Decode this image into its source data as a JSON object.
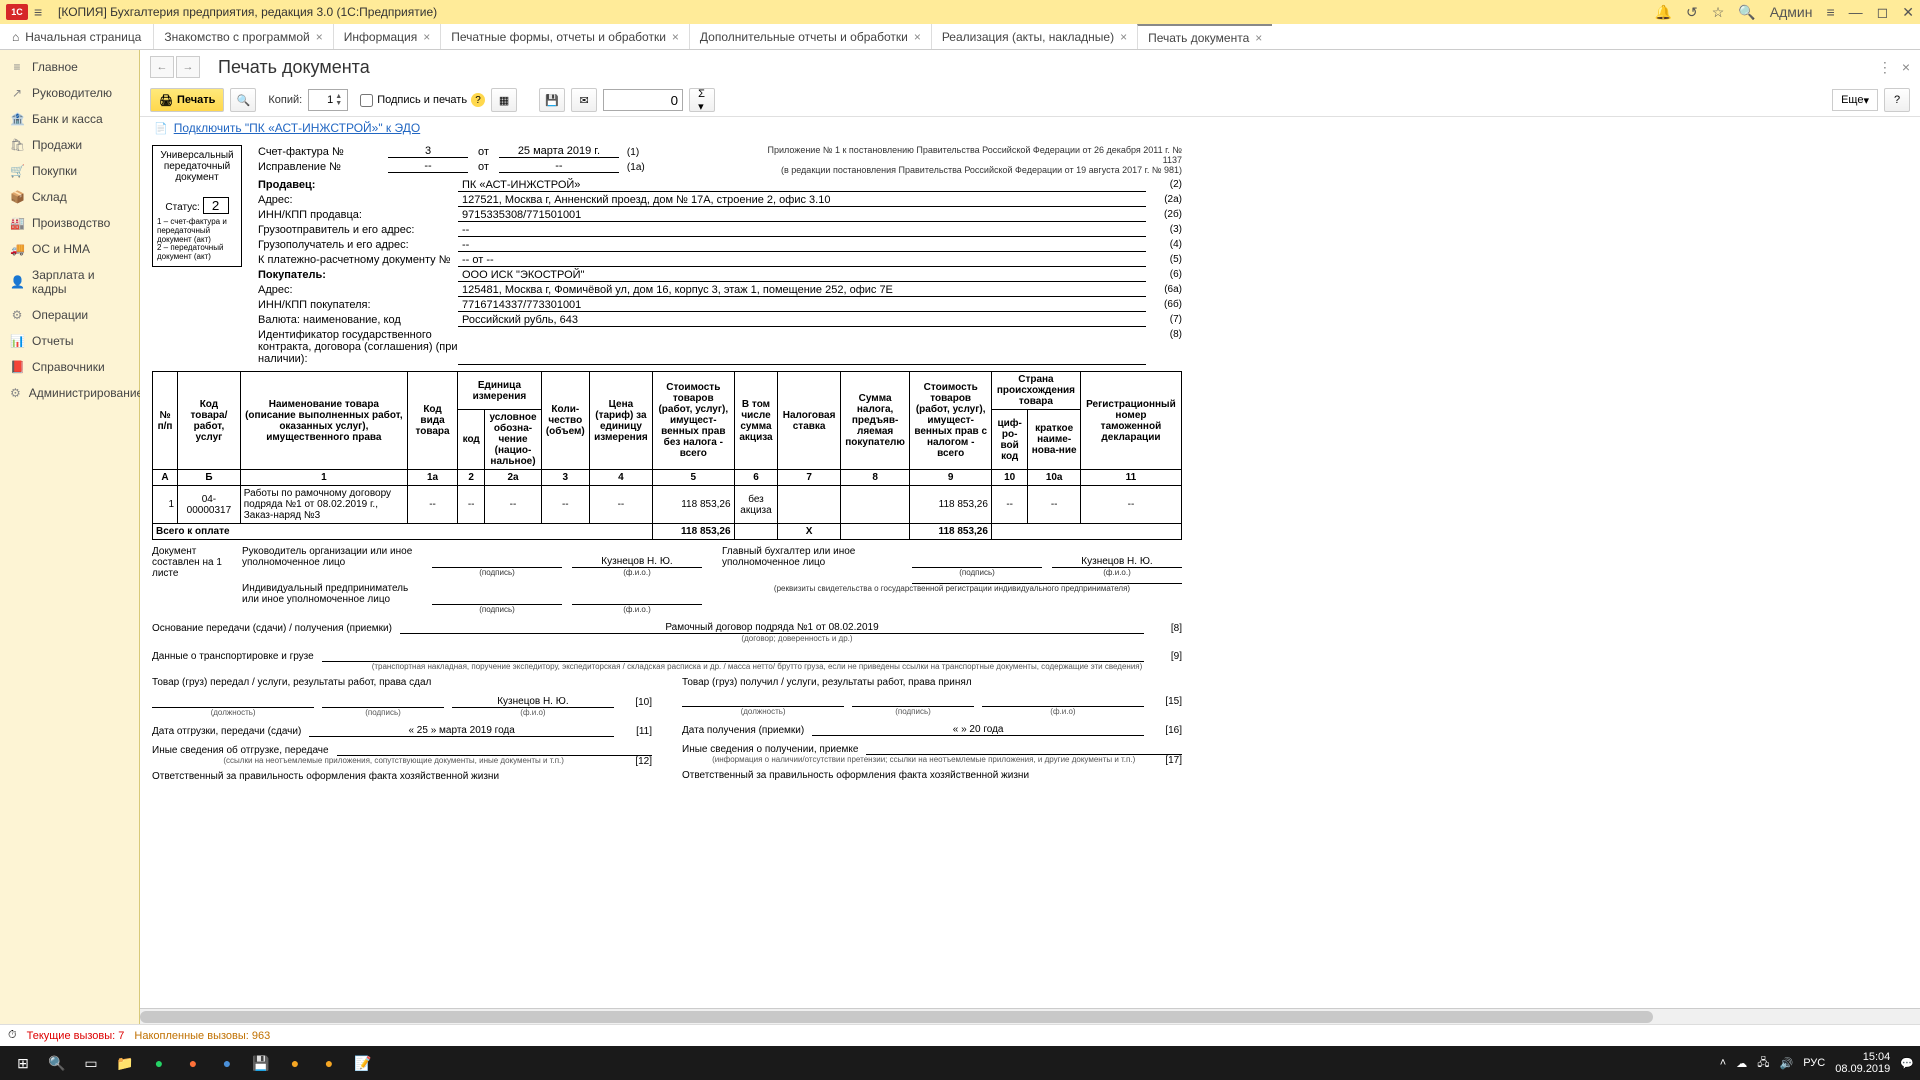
{
  "titlebar": {
    "logo": "1C",
    "title": "[КОПИЯ] Бухгалтерия предприятия, редакция 3.0  (1С:Предприятие)",
    "user": "Админ"
  },
  "tabs": {
    "home": "Начальная страница",
    "items": [
      {
        "label": "Знакомство с программой"
      },
      {
        "label": "Информация"
      },
      {
        "label": "Печатные формы, отчеты и обработки"
      },
      {
        "label": "Дополнительные отчеты и обработки"
      },
      {
        "label": "Реализация (акты, накладные)"
      },
      {
        "label": "Печать документа",
        "active": true
      }
    ]
  },
  "sidebar": [
    {
      "icon": "≡",
      "label": "Главное"
    },
    {
      "icon": "↗",
      "label": "Руководителю"
    },
    {
      "icon": "🏦",
      "label": "Банк и касса"
    },
    {
      "icon": "🛍",
      "label": "Продажи"
    },
    {
      "icon": "🛒",
      "label": "Покупки"
    },
    {
      "icon": "📦",
      "label": "Склад"
    },
    {
      "icon": "🏭",
      "label": "Производство"
    },
    {
      "icon": "🚚",
      "label": "ОС и НМА"
    },
    {
      "icon": "👤",
      "label": "Зарплата и кадры"
    },
    {
      "icon": "⚙",
      "label": "Операции"
    },
    {
      "icon": "📊",
      "label": "Отчеты"
    },
    {
      "icon": "📕",
      "label": "Справочники"
    },
    {
      "icon": "⚙",
      "label": "Администрирование"
    }
  ],
  "page": {
    "title": "Печать документа"
  },
  "toolbar": {
    "print": "Печать",
    "copies_label": "Копий:",
    "copies_value": "1",
    "sign_label": "Подпись и печать",
    "zero": "0",
    "more": "Еще",
    "help": "?"
  },
  "edo": {
    "link": "Подключить \"ПК «АСТ-ИНЖСТРОЙ»\" к ЭДО"
  },
  "upd": {
    "title": "Универсальный передаточный документ",
    "status_label": "Статус:",
    "status_value": "2",
    "status_note": "1 – счет-фактура и передаточный документ (акт)\n2 – передаточный документ (акт)"
  },
  "sf": {
    "label": "Счет-фактура №",
    "number": "3",
    "from": "от",
    "date": "25 марта 2019 г.",
    "code1": "(1)",
    "fix_label": "Исправление №",
    "fix_num": "--",
    "fix_date": "--",
    "code1a": "(1а)"
  },
  "appendix": {
    "line1": "Приложение № 1 к постановлению Правительства Российской Федерации от 26 декабря 2011 г. № 1137",
    "line2": "(в редакции постановления Правительства Российской Федерации от 19 августа 2017 г. № 981)"
  },
  "fields": [
    {
      "label": "Продавец:",
      "value": "ПК «АСТ-ИНЖСТРОЙ»",
      "code": "(2)",
      "bold": true
    },
    {
      "label": "Адрес:",
      "value": "127521, Москва г, Анненский проезд, дом № 17А, строение 2, офис 3.10",
      "code": "(2а)"
    },
    {
      "label": "ИНН/КПП продавца:",
      "value": "9715335308/771501001",
      "code": "(2б)"
    },
    {
      "label": "Грузоотправитель и его адрес:",
      "value": "--",
      "code": "(3)"
    },
    {
      "label": "Грузополучатель и его адрес:",
      "value": "--",
      "code": "(4)"
    },
    {
      "label": "К платежно-расчетному документу №",
      "value": "-- от --",
      "code": "(5)"
    },
    {
      "label": "Покупатель:",
      "value": "ООО ИСК \"ЭКОСТРОЙ\"",
      "code": "(6)",
      "bold": true
    },
    {
      "label": "Адрес:",
      "value": "125481, Москва г, Фомичёвой ул, дом 16, корпус 3, этаж 1, помещение 252, офис 7Е",
      "code": "(6а)"
    },
    {
      "label": "ИНН/КПП покупателя:",
      "value": "7716714337/773301001",
      "code": "(6б)"
    },
    {
      "label": "Валюта: наименование, код",
      "value": "Российский рубль, 643",
      "code": "(7)"
    },
    {
      "label": "Идентификатор государственного контракта, договора (соглашения) (при наличии):",
      "value": "",
      "code": "(8)"
    }
  ],
  "table": {
    "headers": {
      "c1": "№ п/п",
      "c2": "Код товара/ работ, услуг",
      "c3": "Наименование товара (описание выполненных работ, оказанных услуг), имущественного права",
      "c4": "Код вида товара",
      "c5": "Единица измерения",
      "c5a": "код",
      "c5b": "условное обозна-чение (нацио-нальное)",
      "c6": "Коли-чество (объем)",
      "c7": "Цена (тариф) за единицу измерения",
      "c8": "Стоимость товаров (работ, услуг), имущест-венных прав без налога - всего",
      "c9": "В том числе сумма акциза",
      "c10": "Налоговая ставка",
      "c11": "Сумма налога, предъяв-ляемая покупателю",
      "c12": "Стоимость товаров (работ, услуг), имущест-венных прав с налогом - всего",
      "c13": "Страна происхождения товара",
      "c13a": "циф-ро-вой код",
      "c13b": "краткое наиме-нова-ние",
      "c14": "Регистрационный номер таможенной декларации"
    },
    "nums": [
      "А",
      "Б",
      "1",
      "1а",
      "2",
      "2а",
      "3",
      "4",
      "5",
      "6",
      "7",
      "8",
      "9",
      "10",
      "10а",
      "11"
    ],
    "rows": [
      {
        "n": "1",
        "code": "04-00000317",
        "name": "Работы по рамочному договору подряда №1 от 08.02.2019 г., Заказ-наряд №3",
        "kind": "--",
        "ucode": "--",
        "uname": "--",
        "qty": "--",
        "price": "--",
        "sum_no_tax": "118 853,26",
        "akciz": "без акциза",
        "rate": "",
        "tax": "",
        "sum_tax": "118 853,26",
        "ccode": "--",
        "cname": "--",
        "decl": "--"
      }
    ],
    "total_label": "Всего к оплате",
    "total_no_tax": "118 853,26",
    "total_x": "X",
    "total_tax": "",
    "total_with_tax": "118 853,26"
  },
  "signatures": {
    "doc_pages": "Документ составлен на 1 листе",
    "ruk_label": "Руководитель организации или иное уполномоченное лицо",
    "ruk_name": "Кузнецов Н. Ю.",
    "buh_label": "Главный бухгалтер или иное уполномоченное лицо",
    "buh_name": "Кузнецов Н. Ю.",
    "ip_label": "Индивидуальный предприниматель или иное уполномоченное лицо",
    "sub_sign": "(подпись)",
    "sub_fio": "(ф.и.о.)",
    "sub_rekv": "(реквизиты свидетельства о государственной  регистрации индивидуального предпринимателя)"
  },
  "transfer": {
    "basis_label": "Основание передачи (сдачи) / получения (приемки)",
    "basis_value": "Рамочный договор подряда №1 от 08.02.2019",
    "basis_sub": "(договор; доверенность и др.)",
    "basis_code": "[8]",
    "transport_label": "Данные о транспортировке и грузе",
    "transport_sub": "(транспортная накладная, поручение экспедитору, экспедиторская / складская расписка и др. / масса нетто/ брутто груза, если не приведены ссылки на транспортные документы, содержащие эти сведения)",
    "transport_code": "[9]"
  },
  "handover": {
    "left_title": "Товар (груз) передал / услуги, результаты работ, права сдал",
    "right_title": "Товар (груз) получил / услуги, результаты работ, права принял",
    "name": "Кузнецов Н. Ю.",
    "code10": "[10]",
    "code15": "[15]",
    "sub_pos": "(должность)",
    "sub_sign": "(подпись)",
    "sub_fio": "(ф.и.о)",
    "ship_date_label": "Дата отгрузки, передачи (сдачи)",
    "ship_date": "« 25 »    марта   2019  года",
    "recv_date_label": "Дата получения (приемки)",
    "recv_date": "«       »                20     года",
    "code11": "[11]",
    "code16": "[16]",
    "other_ship": "Иные сведения об отгрузке, передаче",
    "other_recv": "Иные сведения о получении, приемке",
    "code12": "[12]",
    "code17": "[17]",
    "sub_other_ship": "(ссылки на неотъемлемые приложения, сопутствующие документы, иные документы и т.п.)",
    "sub_other_recv": "(информация о наличии/отсутствии претензии; ссылки на неотъемлемые приложения, и другие  документы и т.п.)",
    "resp_ship": "Ответственный за правильность оформления факта хозяйственной жизни",
    "resp_recv": "Ответственный за правильность оформления факта хозяйственной жизни"
  },
  "status": {
    "current": "Текущие вызовы: 7",
    "accum": "Накопленные вызовы: 963"
  },
  "tray": {
    "lang": "РУС",
    "time": "15:04",
    "date": "08.09.2019"
  }
}
